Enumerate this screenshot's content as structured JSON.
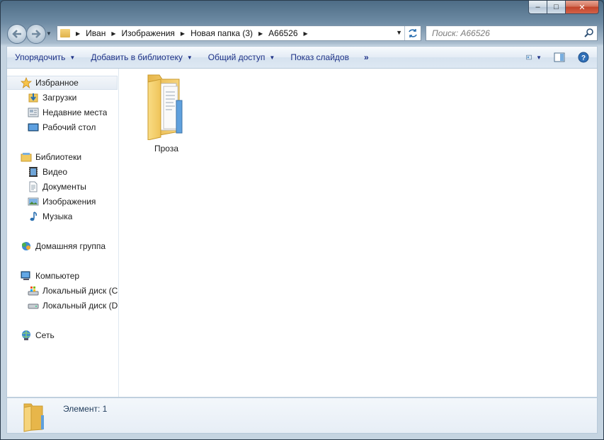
{
  "titlebar": {
    "minimize": "–",
    "maximize": "□",
    "close": "✕"
  },
  "nav_buttons": {
    "back_icon": "arrow-left-icon",
    "forward_icon": "arrow-right-icon"
  },
  "address": {
    "crumbs": [
      "Иван",
      "Изображения",
      "Новая папка (3)",
      "A66526"
    ]
  },
  "search": {
    "placeholder": "Поиск: A66526"
  },
  "toolbar": {
    "organize": "Упорядочить",
    "add_to_library": "Добавить в библиотеку",
    "share": "Общий доступ",
    "slideshow": "Показ слайдов",
    "more": "»"
  },
  "sidebar": {
    "favorites": {
      "label": "Избранное",
      "items": [
        "Загрузки",
        "Недавние места",
        "Рабочий стол"
      ]
    },
    "libraries": {
      "label": "Библиотеки",
      "items": [
        "Видео",
        "Документы",
        "Изображения",
        "Музыка"
      ]
    },
    "homegroup": {
      "label": "Домашняя группа"
    },
    "computer": {
      "label": "Компьютер",
      "items": [
        "Локальный диск (C",
        "Локальный диск (D"
      ]
    },
    "network": {
      "label": "Сеть"
    }
  },
  "files": [
    {
      "name": "Проза",
      "type": "folder"
    }
  ],
  "status": {
    "count": "Элемент: 1"
  },
  "colors": {
    "accent": "#1e3287",
    "folder": "#f0c960"
  }
}
